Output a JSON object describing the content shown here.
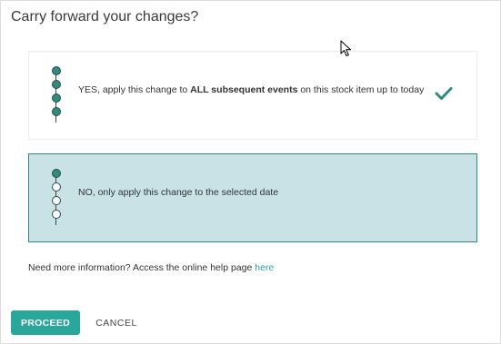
{
  "dialog": {
    "title": "Carry forward your changes?"
  },
  "options": [
    {
      "text_prefix": "YES, apply this change to ",
      "text_bold": "ALL subsequent events",
      "text_suffix": " on this stock item up to today",
      "selected": false,
      "confirmed": true,
      "dots": [
        "filled",
        "filled",
        "filled",
        "filled"
      ]
    },
    {
      "text": "NO, only apply this change to the selected date",
      "selected": true,
      "dots": [
        "filled",
        "empty",
        "empty",
        "empty"
      ]
    }
  ],
  "help": {
    "text": "Need more information? Access the online help page ",
    "link_label": "here"
  },
  "buttons": {
    "proceed": "PROCEED",
    "cancel": "CANCEL"
  },
  "colors": {
    "accent": "#2aa79b",
    "selected_bg": "#c8e2e6",
    "selected_border": "#2e8b7f",
    "link": "#2a9d9a"
  },
  "icons": {
    "check": "check-icon",
    "cursor": "mouse-cursor-icon"
  }
}
